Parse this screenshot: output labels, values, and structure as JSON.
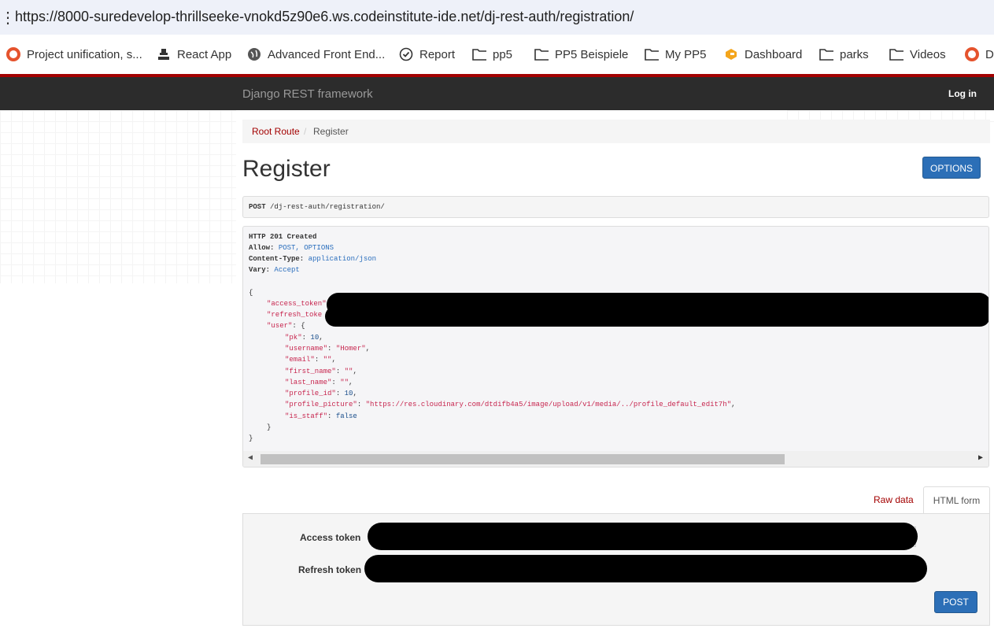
{
  "browser": {
    "url": "https://8000-suredevelop-thrillseeke-vnokd5z90e6.ws.codeinstitute-ide.net/dj-rest-auth/registration/",
    "bookmarks": [
      {
        "label": "Project unification, s...",
        "icon": "circle-o-icon"
      },
      {
        "label": "React App",
        "icon": "tool-icon"
      },
      {
        "label": "Advanced Front End...",
        "icon": "globe-icon"
      },
      {
        "label": "Report",
        "icon": "check-circle-icon"
      },
      {
        "label": "pp5",
        "icon": "folder-icon"
      },
      {
        "label": "PP5 Beispiele",
        "icon": "folder-icon"
      },
      {
        "label": "My PP5",
        "icon": "folder-icon"
      },
      {
        "label": "Dashboard",
        "icon": "g-logo-icon"
      },
      {
        "label": "parks",
        "icon": "folder-icon"
      },
      {
        "label": "Videos",
        "icon": "folder-icon"
      },
      {
        "label": "D",
        "icon": "circle-o-icon"
      }
    ]
  },
  "navbar": {
    "brand": "Django REST framework",
    "login": "Log in"
  },
  "breadcrumb": {
    "root": "Root Route",
    "separator": "/",
    "current": "Register"
  },
  "page": {
    "title": "Register",
    "options_label": "OPTIONS"
  },
  "request": {
    "method": "POST",
    "path": "/dj-rest-auth/registration/"
  },
  "response": {
    "status": "HTTP 201 Created",
    "headers": [
      {
        "name": "Allow:",
        "value": "POST, OPTIONS"
      },
      {
        "name": "Content-Type:",
        "value": "application/json"
      },
      {
        "name": "Vary:",
        "value": "Accept"
      }
    ],
    "body": {
      "open": "{",
      "access_token_key": "\"access_token\"",
      "refresh_token_key": "\"refresh_toke",
      "user_key": "\"user\"",
      "user_open": ": {",
      "fields": [
        {
          "key": "\"pk\"",
          "value": "10",
          "kind": "num",
          "comma": ","
        },
        {
          "key": "\"username\"",
          "value": "\"Homer\"",
          "kind": "str",
          "comma": ","
        },
        {
          "key": "\"email\"",
          "value": "\"\"",
          "kind": "str",
          "comma": ","
        },
        {
          "key": "\"first_name\"",
          "value": "\"\"",
          "kind": "str",
          "comma": ","
        },
        {
          "key": "\"last_name\"",
          "value": "\"\"",
          "kind": "str",
          "comma": ","
        },
        {
          "key": "\"profile_id\"",
          "value": "10",
          "kind": "num",
          "comma": ","
        },
        {
          "key": "\"profile_picture\"",
          "value": "\"https://res.cloudinary.com/dtdifb4a5/image/upload/v1/media/../profile_default_edit7h\"",
          "kind": "str",
          "comma": ","
        },
        {
          "key": "\"is_staff\"",
          "value": "false",
          "kind": "kw",
          "comma": ""
        }
      ],
      "user_close": "}",
      "close": "}"
    }
  },
  "tabs": {
    "raw": "Raw data",
    "html": "HTML form"
  },
  "form": {
    "access_label": "Access token",
    "refresh_label": "Refresh token",
    "submit": "POST"
  }
}
